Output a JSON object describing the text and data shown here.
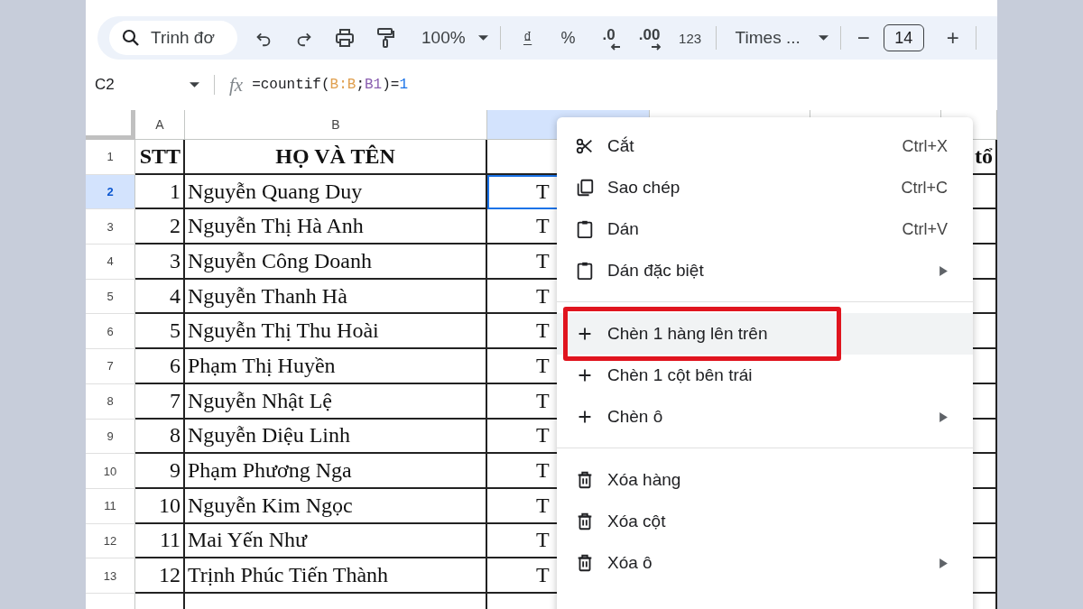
{
  "toolbar": {
    "search": {
      "placeholder": "Trinh đơ"
    },
    "zoom": "100%",
    "currency": "₫",
    "percent": "%",
    "decrease_decimal": ".0",
    "increase_decimal": ".00",
    "number_format": "123",
    "font": "Times ...",
    "font_size_minus": "−",
    "font_size": "14",
    "font_size_plus": "+"
  },
  "formula_bar": {
    "name_box": "C2",
    "fx": "fx",
    "formula": [
      {
        "text": "=countif(",
        "color": "#202124"
      },
      {
        "text": "B:B",
        "color": "#e0a050"
      },
      {
        "text": ";",
        "color": "#202124"
      },
      {
        "text": "B1",
        "color": "#8a5fb0"
      },
      {
        "text": ")=",
        "color": "#202124"
      },
      {
        "text": "1",
        "color": "#1a73e8"
      }
    ]
  },
  "sheet": {
    "columns": [
      {
        "label": "A",
        "selected": false
      },
      {
        "label": "B",
        "selected": false
      },
      {
        "selected": true
      },
      {
        "selected": false
      },
      {
        "selected": false
      },
      {
        "selected": false
      }
    ],
    "rows": [
      {
        "number": "1",
        "selected": false,
        "kind": "header",
        "a": "STT",
        "b": "HỌ VÀ TÊN",
        "f": "tổ"
      },
      {
        "number": "2",
        "selected": true,
        "kind": "data",
        "a": "1",
        "b": "Nguyễn Quang Duy",
        "c": "T"
      },
      {
        "number": "3",
        "selected": false,
        "kind": "data",
        "a": "2",
        "b": "Nguyễn Thị Hà Anh",
        "c": "T"
      },
      {
        "number": "4",
        "selected": false,
        "kind": "data",
        "a": "3",
        "b": "Nguyễn Công Doanh",
        "c": "T"
      },
      {
        "number": "5",
        "selected": false,
        "kind": "data",
        "a": "4",
        "b": "Nguyễn Thanh Hà",
        "c": "T"
      },
      {
        "number": "6",
        "selected": false,
        "kind": "data",
        "a": "5",
        "b": "Nguyễn Thị Thu Hoài",
        "c": "T"
      },
      {
        "number": "7",
        "selected": false,
        "kind": "data",
        "a": "6",
        "b": "Phạm Thị Huyền",
        "c": "T"
      },
      {
        "number": "8",
        "selected": false,
        "kind": "data",
        "a": "7",
        "b": "Nguyễn Nhật Lệ",
        "c": "T"
      },
      {
        "number": "9",
        "selected": false,
        "kind": "data",
        "a": "8",
        "b": "Nguyễn Diệu Linh",
        "c": "T"
      },
      {
        "number": "10",
        "selected": false,
        "kind": "data",
        "a": "9",
        "b": "Phạm Phương Nga",
        "c": "T"
      },
      {
        "number": "11",
        "selected": false,
        "kind": "data",
        "a": "10",
        "b": "Nguyễn Kim Ngọc",
        "c": "T"
      },
      {
        "number": "12",
        "selected": false,
        "kind": "data",
        "a": "11",
        "b": "Mai Yến Như",
        "c": "T"
      },
      {
        "number": "13",
        "selected": false,
        "kind": "data",
        "a": "12",
        "b": "Trịnh Phúc Tiến Thành",
        "c": "T"
      }
    ]
  },
  "context_menu": {
    "sections": [
      [
        {
          "kind": "cut",
          "label": "Cắt",
          "shortcut": "Ctrl+X",
          "submenu": false,
          "selected": false,
          "highlighted": false
        },
        {
          "kind": "copy",
          "label": "Sao chép",
          "shortcut": "Ctrl+C",
          "submenu": false,
          "selected": false,
          "highlighted": false
        },
        {
          "kind": "paste",
          "label": "Dán",
          "shortcut": "Ctrl+V",
          "submenu": false,
          "selected": false,
          "highlighted": false
        },
        {
          "kind": "paste",
          "label": "Dán đặc biệt",
          "submenu": true,
          "selected": false,
          "highlighted": false
        }
      ],
      [
        {
          "kind": "insert",
          "label": "Chèn 1 hàng lên trên",
          "submenu": false,
          "selected": true,
          "highlighted": true
        },
        {
          "kind": "insert",
          "label": "Chèn 1 cột bên trái",
          "submenu": false,
          "selected": false,
          "highlighted": false
        },
        {
          "kind": "insert",
          "label": "Chèn ô",
          "submenu": true,
          "selected": false,
          "highlighted": false
        }
      ],
      [
        {
          "kind": "delete",
          "label": "Xóa hàng",
          "submenu": false,
          "selected": false,
          "highlighted": false
        },
        {
          "kind": "delete",
          "label": "Xóa cột",
          "submenu": false,
          "selected": false,
          "highlighted": false
        },
        {
          "kind": "delete",
          "label": "Xóa ô",
          "submenu": true,
          "selected": false,
          "highlighted": false
        }
      ]
    ]
  }
}
